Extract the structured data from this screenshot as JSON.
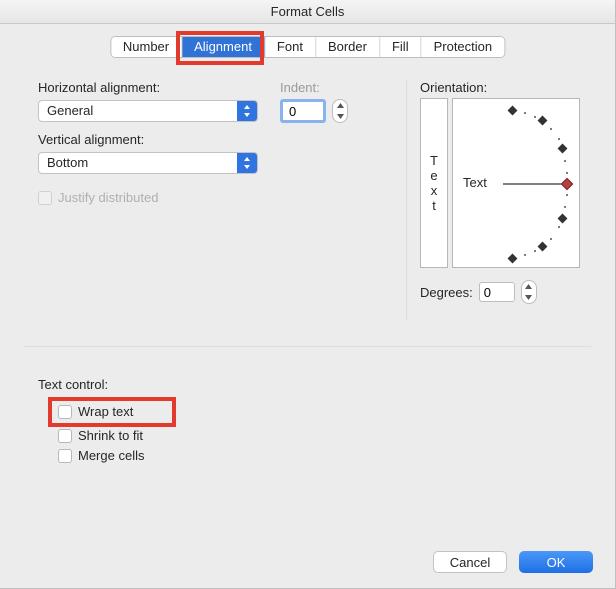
{
  "title": "Format Cells",
  "tabs": {
    "number": "Number",
    "alignment": "Alignment",
    "font": "Font",
    "border": "Border",
    "fill": "Fill",
    "protection": "Protection"
  },
  "labels": {
    "horizontal": "Horizontal alignment:",
    "vertical": "Vertical alignment:",
    "indent": "Indent:",
    "orientation": "Orientation:",
    "justify": "Justify distributed",
    "degrees": "Degrees:",
    "textControl": "Text control:",
    "wrap": "Wrap text",
    "shrink": "Shrink to fit",
    "merge": "Merge cells"
  },
  "values": {
    "horizontal": "General",
    "vertical": "Bottom",
    "indent": "0",
    "degrees": "0",
    "orientText": "Text",
    "orientVertT": "T",
    "orientVertE": "e",
    "orientVertX": "x",
    "orientVertT2": "t"
  },
  "buttons": {
    "cancel": "Cancel",
    "ok": "OK"
  }
}
